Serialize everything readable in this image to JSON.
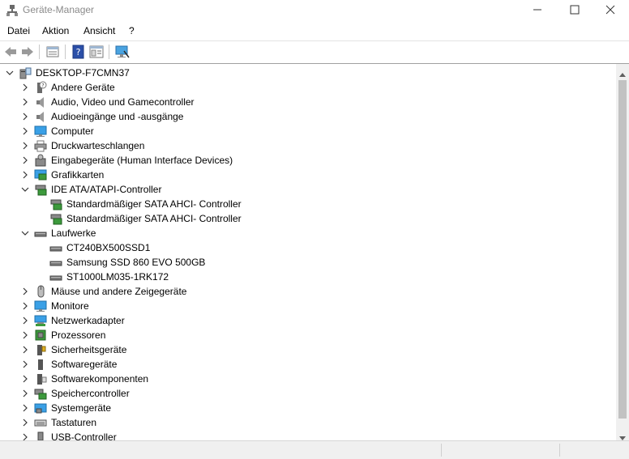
{
  "window": {
    "title": "Geräte-Manager",
    "minimize_icon": "minimize-icon",
    "maximize_icon": "maximize-icon",
    "close_icon": "close-icon"
  },
  "menu": {
    "items": [
      "Datei",
      "Aktion",
      "Ansicht",
      "?"
    ]
  },
  "toolbar": {
    "buttons": [
      "back-arrow-icon",
      "forward-arrow-icon",
      "properties-icon",
      "help-icon",
      "view-icon",
      "monitor-scan-icon"
    ]
  },
  "tree": {
    "root": {
      "label": "DESKTOP-F7CMN37",
      "icon": "computer-tower-icon",
      "expanded": true
    },
    "nodes": [
      {
        "label": "Andere Geräte",
        "icon": "unknown-device-icon",
        "expanded": false
      },
      {
        "label": "Audio, Video und Gamecontroller",
        "icon": "speaker-icon",
        "expanded": false
      },
      {
        "label": "Audioeingänge und -ausgänge",
        "icon": "speaker-icon",
        "expanded": false
      },
      {
        "label": "Computer",
        "icon": "monitor-icon",
        "expanded": false
      },
      {
        "label": "Druckwarteschlangen",
        "icon": "printer-icon",
        "expanded": false
      },
      {
        "label": "Eingabegeräte (Human Interface Devices)",
        "icon": "hid-icon",
        "expanded": false
      },
      {
        "label": "Grafikkarten",
        "icon": "graphics-card-icon",
        "expanded": false
      },
      {
        "label": "IDE ATA/ATAPI-Controller",
        "icon": "ide-controller-icon",
        "expanded": true,
        "children": [
          {
            "label": "Standardmäßiger SATA AHCI- Controller",
            "icon": "ide-controller-icon"
          },
          {
            "label": "Standardmäßiger SATA AHCI- Controller",
            "icon": "ide-controller-icon"
          }
        ]
      },
      {
        "label": "Laufwerke",
        "icon": "drive-icon",
        "expanded": true,
        "children": [
          {
            "label": "CT240BX500SSD1",
            "icon": "drive-icon"
          },
          {
            "label": "Samsung SSD 860 EVO 500GB",
            "icon": "drive-icon"
          },
          {
            "label": "ST1000LM035-1RK172",
            "icon": "drive-icon"
          }
        ]
      },
      {
        "label": "Mäuse und andere Zeigegeräte",
        "icon": "mouse-icon",
        "expanded": false
      },
      {
        "label": "Monitore",
        "icon": "monitor-icon",
        "expanded": false
      },
      {
        "label": "Netzwerkadapter",
        "icon": "network-adapter-icon",
        "expanded": false
      },
      {
        "label": "Prozessoren",
        "icon": "processor-icon",
        "expanded": false
      },
      {
        "label": "Sicherheitsgeräte",
        "icon": "security-device-icon",
        "expanded": false
      },
      {
        "label": "Softwaregeräte",
        "icon": "software-device-icon",
        "expanded": false
      },
      {
        "label": "Softwarekomponenten",
        "icon": "software-component-icon",
        "expanded": false
      },
      {
        "label": "Speichercontroller",
        "icon": "storage-controller-icon",
        "expanded": false
      },
      {
        "label": "Systemgeräte",
        "icon": "system-device-icon",
        "expanded": false
      },
      {
        "label": "Tastaturen",
        "icon": "keyboard-icon",
        "expanded": false
      },
      {
        "label": "USB-Controller",
        "icon": "usb-icon",
        "expanded": false
      }
    ]
  },
  "colors": {
    "accent": "#2a7fd4",
    "title_text": "#8a8a8a"
  }
}
